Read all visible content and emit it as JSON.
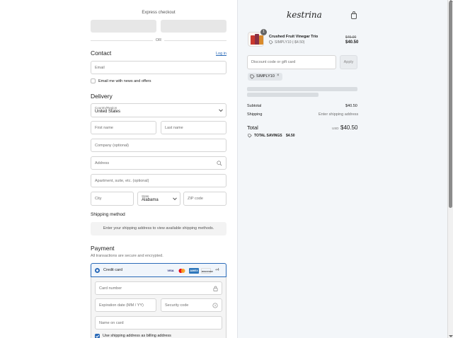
{
  "express": {
    "title": "Express checkout",
    "or_label": "OR"
  },
  "contact": {
    "heading": "Contact",
    "login_link": "Log in",
    "email_placeholder": "Email",
    "newsletter_label": "Email me with news and offers"
  },
  "delivery": {
    "heading": "Delivery",
    "country_label": "Country/Region",
    "country_value": "United States",
    "first_name_placeholder": "First name",
    "last_name_placeholder": "Last name",
    "company_placeholder": "Company (optional)",
    "address_placeholder": "Address",
    "apartment_placeholder": "Apartment, suite, etc. (optional)",
    "city_placeholder": "City",
    "state_label": "State",
    "state_value": "Alabama",
    "zip_placeholder": "ZIP code"
  },
  "shipping_method": {
    "heading": "Shipping method",
    "message": "Enter your shipping address to view available shipping methods."
  },
  "payment": {
    "heading": "Payment",
    "subtitle": "All transactions are secure and encrypted.",
    "credit_card_label": "Credit card",
    "card_brands": [
      "VISA",
      "MC",
      "AMEX",
      "DISCOVER"
    ],
    "more_brands": "+4",
    "card_number_placeholder": "Card number",
    "expiration_placeholder": "Expiration date (MM / YY)",
    "security_code_placeholder": "Security code",
    "name_on_card_placeholder": "Name on card",
    "billing_same_label": "Use shipping address as billing address"
  },
  "summary": {
    "logo_text": "kestrina",
    "item": {
      "quantity": "1",
      "name": "Crushed Fruit Vinegar Trio",
      "discount_label": "SIMPLY10 (-$4.50)",
      "original_price": "$45.00",
      "price": "$40.50"
    },
    "discount_placeholder": "Discount code or gift card",
    "apply_label": "Apply",
    "applied_code": "SIMPLY10",
    "subtotal_label": "Subtotal",
    "subtotal_value": "$40.50",
    "shipping_label": "Shipping",
    "shipping_value": "Enter shipping address",
    "total_label": "Total",
    "currency": "USD",
    "total_value": "$40.50",
    "savings_label": "TOTAL SAVINGS",
    "savings_value": "$4.50"
  },
  "colors": {
    "accent_blue": "#2a6ab8",
    "summary_bg": "#f3f6f9",
    "button_gray": "#e7e7e7"
  }
}
